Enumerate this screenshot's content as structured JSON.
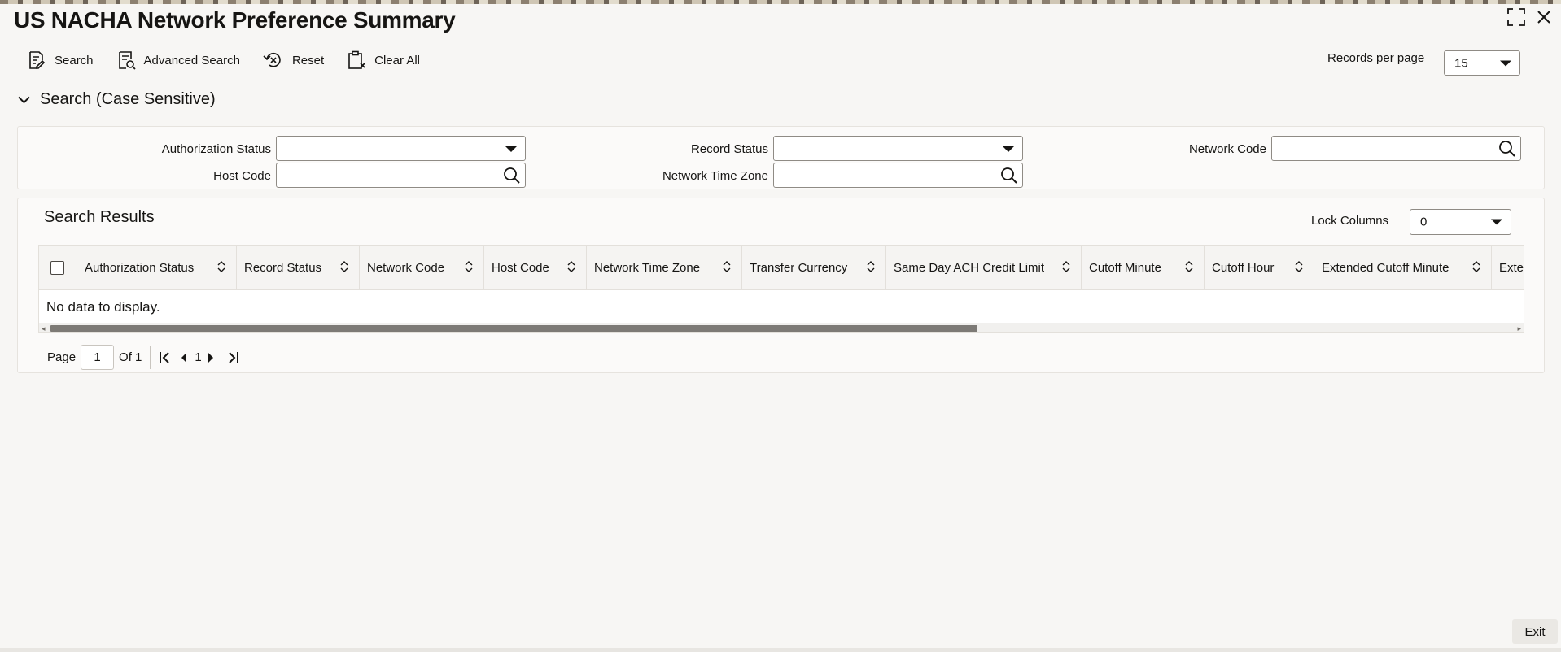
{
  "window": {
    "title": "US NACHA Network Preference Summary"
  },
  "toolbar": {
    "search_label": "Search",
    "advanced_search_label": "Advanced Search",
    "reset_label": "Reset",
    "clear_all_label": "Clear All"
  },
  "records_per_page": {
    "label": "Records per page",
    "value": "15"
  },
  "search_section": {
    "title": "Search (Case Sensitive)",
    "fields": {
      "authorization_status": {
        "label": "Authorization Status",
        "value": ""
      },
      "record_status": {
        "label": "Record Status",
        "value": ""
      },
      "network_code": {
        "label": "Network Code",
        "value": ""
      },
      "host_code": {
        "label": "Host Code",
        "value": ""
      },
      "network_time_zone": {
        "label": "Network Time Zone",
        "value": ""
      }
    }
  },
  "results": {
    "title": "Search Results",
    "lock_columns": {
      "label": "Lock Columns",
      "value": "0"
    },
    "columns": [
      "Authorization Status",
      "Record Status",
      "Network Code",
      "Host Code",
      "Network Time Zone",
      "Transfer Currency",
      "Same Day ACH Credit Limit",
      "Cutoff Minute",
      "Cutoff Hour",
      "Extended Cutoff Minute",
      "Exten"
    ],
    "empty_message": "No data to display."
  },
  "pagination": {
    "page_label": "Page",
    "current_page": "1",
    "of_label": "Of 1",
    "page_number": "1"
  },
  "footer": {
    "exit_label": "Exit"
  }
}
